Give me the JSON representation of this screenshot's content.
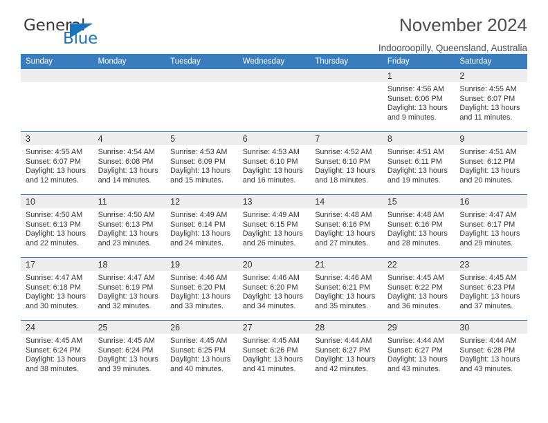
{
  "brand": {
    "word_one": "General",
    "word_two": "Blue",
    "accent_color": "#1c73bd"
  },
  "header": {
    "title": "November 2024",
    "subtitle": "Indooroopilly, Queensland, Australia"
  },
  "calendar": {
    "header_bg": "#3a7dbf",
    "daynum_bg": "#ededed",
    "weekdays": [
      "Sunday",
      "Monday",
      "Tuesday",
      "Wednesday",
      "Thursday",
      "Friday",
      "Saturday"
    ],
    "labels": {
      "sunrise": "Sunrise:",
      "sunset": "Sunset:",
      "daylight": "Daylight:"
    },
    "weeks": [
      [
        {
          "day": "",
          "sunrise": "",
          "sunset": "",
          "daylight_1": "",
          "daylight_2": ""
        },
        {
          "day": "",
          "sunrise": "",
          "sunset": "",
          "daylight_1": "",
          "daylight_2": ""
        },
        {
          "day": "",
          "sunrise": "",
          "sunset": "",
          "daylight_1": "",
          "daylight_2": ""
        },
        {
          "day": "",
          "sunrise": "",
          "sunset": "",
          "daylight_1": "",
          "daylight_2": ""
        },
        {
          "day": "",
          "sunrise": "",
          "sunset": "",
          "daylight_1": "",
          "daylight_2": ""
        },
        {
          "day": "1",
          "sunrise": "Sunrise: 4:56 AM",
          "sunset": "Sunset: 6:06 PM",
          "daylight_1": "Daylight: 13 hours",
          "daylight_2": "and 9 minutes."
        },
        {
          "day": "2",
          "sunrise": "Sunrise: 4:55 AM",
          "sunset": "Sunset: 6:07 PM",
          "daylight_1": "Daylight: 13 hours",
          "daylight_2": "and 11 minutes."
        }
      ],
      [
        {
          "day": "3",
          "sunrise": "Sunrise: 4:55 AM",
          "sunset": "Sunset: 6:07 PM",
          "daylight_1": "Daylight: 13 hours",
          "daylight_2": "and 12 minutes."
        },
        {
          "day": "4",
          "sunrise": "Sunrise: 4:54 AM",
          "sunset": "Sunset: 6:08 PM",
          "daylight_1": "Daylight: 13 hours",
          "daylight_2": "and 14 minutes."
        },
        {
          "day": "5",
          "sunrise": "Sunrise: 4:53 AM",
          "sunset": "Sunset: 6:09 PM",
          "daylight_1": "Daylight: 13 hours",
          "daylight_2": "and 15 minutes."
        },
        {
          "day": "6",
          "sunrise": "Sunrise: 4:53 AM",
          "sunset": "Sunset: 6:10 PM",
          "daylight_1": "Daylight: 13 hours",
          "daylight_2": "and 16 minutes."
        },
        {
          "day": "7",
          "sunrise": "Sunrise: 4:52 AM",
          "sunset": "Sunset: 6:10 PM",
          "daylight_1": "Daylight: 13 hours",
          "daylight_2": "and 18 minutes."
        },
        {
          "day": "8",
          "sunrise": "Sunrise: 4:51 AM",
          "sunset": "Sunset: 6:11 PM",
          "daylight_1": "Daylight: 13 hours",
          "daylight_2": "and 19 minutes."
        },
        {
          "day": "9",
          "sunrise": "Sunrise: 4:51 AM",
          "sunset": "Sunset: 6:12 PM",
          "daylight_1": "Daylight: 13 hours",
          "daylight_2": "and 20 minutes."
        }
      ],
      [
        {
          "day": "10",
          "sunrise": "Sunrise: 4:50 AM",
          "sunset": "Sunset: 6:13 PM",
          "daylight_1": "Daylight: 13 hours",
          "daylight_2": "and 22 minutes."
        },
        {
          "day": "11",
          "sunrise": "Sunrise: 4:50 AM",
          "sunset": "Sunset: 6:13 PM",
          "daylight_1": "Daylight: 13 hours",
          "daylight_2": "and 23 minutes."
        },
        {
          "day": "12",
          "sunrise": "Sunrise: 4:49 AM",
          "sunset": "Sunset: 6:14 PM",
          "daylight_1": "Daylight: 13 hours",
          "daylight_2": "and 24 minutes."
        },
        {
          "day": "13",
          "sunrise": "Sunrise: 4:49 AM",
          "sunset": "Sunset: 6:15 PM",
          "daylight_1": "Daylight: 13 hours",
          "daylight_2": "and 26 minutes."
        },
        {
          "day": "14",
          "sunrise": "Sunrise: 4:48 AM",
          "sunset": "Sunset: 6:16 PM",
          "daylight_1": "Daylight: 13 hours",
          "daylight_2": "and 27 minutes."
        },
        {
          "day": "15",
          "sunrise": "Sunrise: 4:48 AM",
          "sunset": "Sunset: 6:16 PM",
          "daylight_1": "Daylight: 13 hours",
          "daylight_2": "and 28 minutes."
        },
        {
          "day": "16",
          "sunrise": "Sunrise: 4:47 AM",
          "sunset": "Sunset: 6:17 PM",
          "daylight_1": "Daylight: 13 hours",
          "daylight_2": "and 29 minutes."
        }
      ],
      [
        {
          "day": "17",
          "sunrise": "Sunrise: 4:47 AM",
          "sunset": "Sunset: 6:18 PM",
          "daylight_1": "Daylight: 13 hours",
          "daylight_2": "and 30 minutes."
        },
        {
          "day": "18",
          "sunrise": "Sunrise: 4:47 AM",
          "sunset": "Sunset: 6:19 PM",
          "daylight_1": "Daylight: 13 hours",
          "daylight_2": "and 32 minutes."
        },
        {
          "day": "19",
          "sunrise": "Sunrise: 4:46 AM",
          "sunset": "Sunset: 6:20 PM",
          "daylight_1": "Daylight: 13 hours",
          "daylight_2": "and 33 minutes."
        },
        {
          "day": "20",
          "sunrise": "Sunrise: 4:46 AM",
          "sunset": "Sunset: 6:20 PM",
          "daylight_1": "Daylight: 13 hours",
          "daylight_2": "and 34 minutes."
        },
        {
          "day": "21",
          "sunrise": "Sunrise: 4:46 AM",
          "sunset": "Sunset: 6:21 PM",
          "daylight_1": "Daylight: 13 hours",
          "daylight_2": "and 35 minutes."
        },
        {
          "day": "22",
          "sunrise": "Sunrise: 4:45 AM",
          "sunset": "Sunset: 6:22 PM",
          "daylight_1": "Daylight: 13 hours",
          "daylight_2": "and 36 minutes."
        },
        {
          "day": "23",
          "sunrise": "Sunrise: 4:45 AM",
          "sunset": "Sunset: 6:23 PM",
          "daylight_1": "Daylight: 13 hours",
          "daylight_2": "and 37 minutes."
        }
      ],
      [
        {
          "day": "24",
          "sunrise": "Sunrise: 4:45 AM",
          "sunset": "Sunset: 6:24 PM",
          "daylight_1": "Daylight: 13 hours",
          "daylight_2": "and 38 minutes."
        },
        {
          "day": "25",
          "sunrise": "Sunrise: 4:45 AM",
          "sunset": "Sunset: 6:24 PM",
          "daylight_1": "Daylight: 13 hours",
          "daylight_2": "and 39 minutes."
        },
        {
          "day": "26",
          "sunrise": "Sunrise: 4:45 AM",
          "sunset": "Sunset: 6:25 PM",
          "daylight_1": "Daylight: 13 hours",
          "daylight_2": "and 40 minutes."
        },
        {
          "day": "27",
          "sunrise": "Sunrise: 4:45 AM",
          "sunset": "Sunset: 6:26 PM",
          "daylight_1": "Daylight: 13 hours",
          "daylight_2": "and 41 minutes."
        },
        {
          "day": "28",
          "sunrise": "Sunrise: 4:44 AM",
          "sunset": "Sunset: 6:27 PM",
          "daylight_1": "Daylight: 13 hours",
          "daylight_2": "and 42 minutes."
        },
        {
          "day": "29",
          "sunrise": "Sunrise: 4:44 AM",
          "sunset": "Sunset: 6:27 PM",
          "daylight_1": "Daylight: 13 hours",
          "daylight_2": "and 43 minutes."
        },
        {
          "day": "30",
          "sunrise": "Sunrise: 4:44 AM",
          "sunset": "Sunset: 6:28 PM",
          "daylight_1": "Daylight: 13 hours",
          "daylight_2": "and 43 minutes."
        }
      ]
    ]
  }
}
